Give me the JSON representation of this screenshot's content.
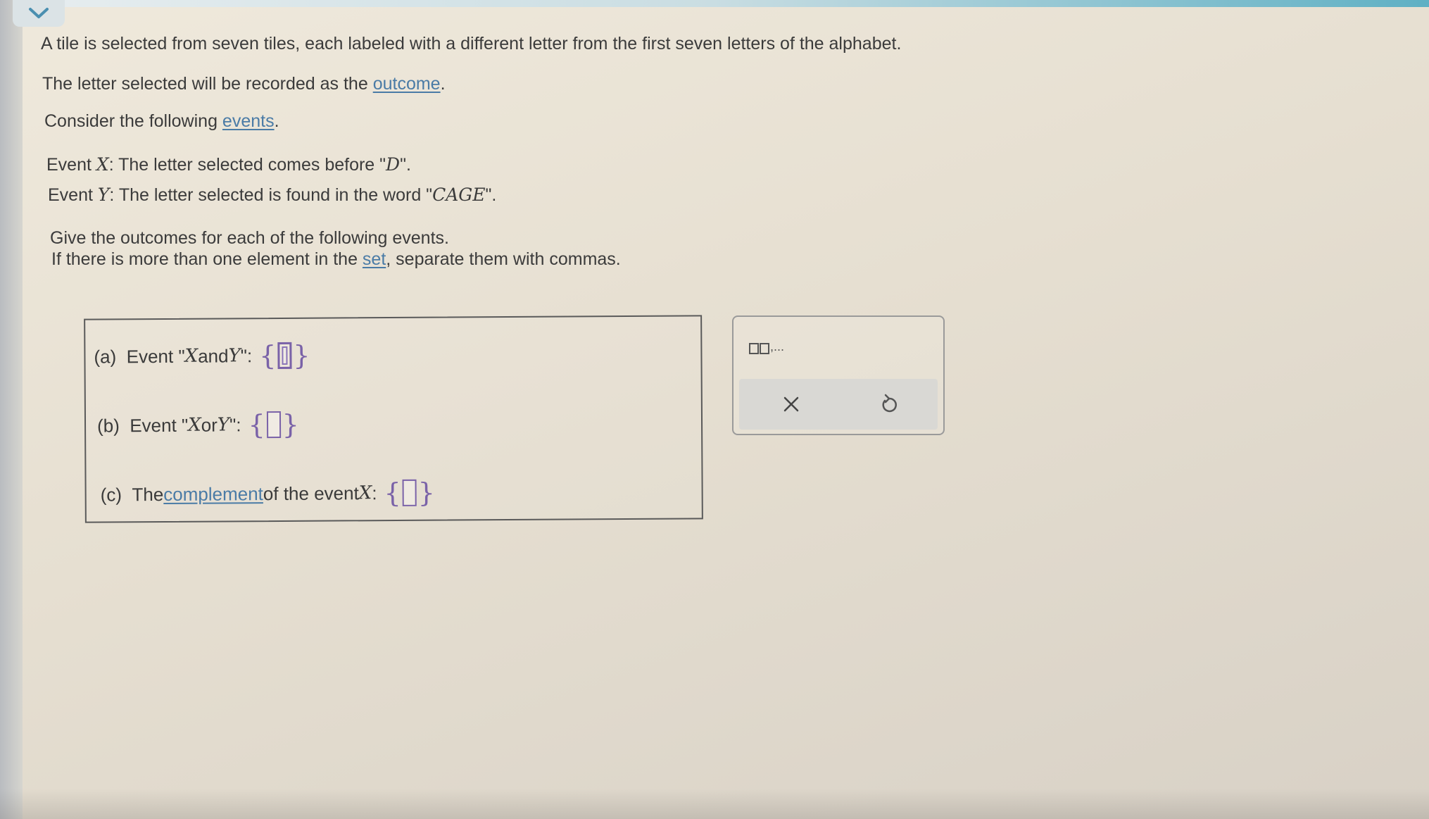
{
  "icons": {
    "collapse": "chevron-down-icon",
    "clear": "x-icon",
    "undo": "undo-icon",
    "set_template": "set-template-icon"
  },
  "colors": {
    "link": "#4a7ba6",
    "input_accent": "#7a62a8",
    "top_bar_accent": "#5fb0c4"
  },
  "question": {
    "line1": "A tile is selected from seven tiles, each labeled with a different letter from the first seven letters of the alphabet.",
    "line2_prefix": "The letter selected will be recorded as the ",
    "line2_link": "outcome",
    "line2_suffix": ".",
    "line3_prefix": "Consider the following ",
    "line3_link": "events",
    "line3_suffix": ".",
    "eventX_prefix": "Event ",
    "eventX_var": "X",
    "eventX_text": ": The letter selected comes before \"",
    "eventX_letter": "D",
    "eventX_end": "\".",
    "eventY_prefix": "Event ",
    "eventY_var": "Y",
    "eventY_text": ": The letter selected is found in the word \"",
    "eventY_word": "CAGE",
    "eventY_end": "\".",
    "instr1": "Give the outcomes for each of the following events.",
    "instr2_prefix": "If there is more than one element in the ",
    "instr2_link": "set",
    "instr2_suffix": ", separate them with commas."
  },
  "parts": {
    "a": {
      "label": "(a)",
      "pre": "Event \"",
      "var1": "X",
      "mid": " and ",
      "var2": "Y",
      "post": " \":"
    },
    "b": {
      "label": "(b)",
      "pre": "Event \"",
      "var1": "X",
      "mid": " or ",
      "var2": "Y",
      "post": " \":"
    },
    "c": {
      "label": "(c)",
      "pre": "The ",
      "link": "complement",
      "mid": " of the event ",
      "var1": "X",
      "post": ":"
    }
  },
  "set_braces": {
    "open": "{",
    "close": "}"
  },
  "toolbar": {
    "set_template_label": ",..."
  }
}
